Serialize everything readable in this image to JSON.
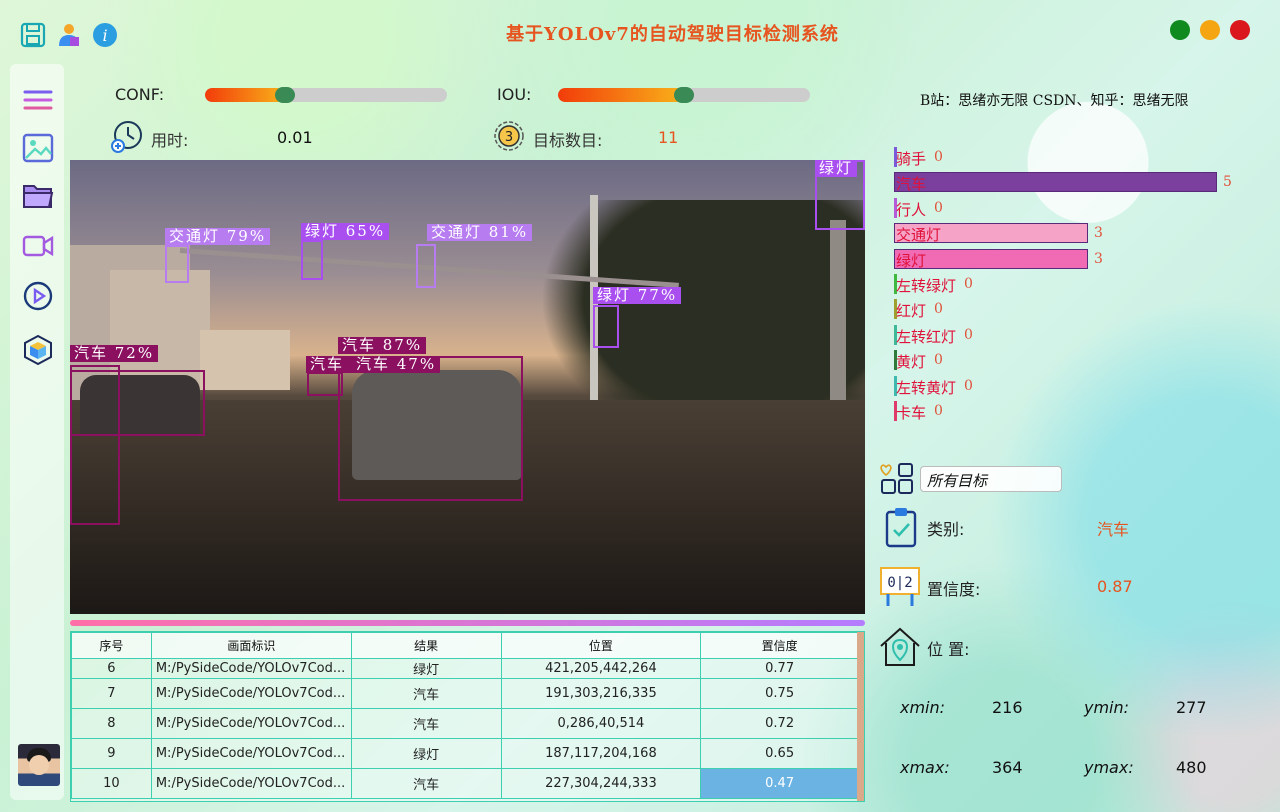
{
  "window": {
    "title": "基于YOLOv7的自动驾驶目标检测系统",
    "buttons": {
      "close_color": "#d9171c",
      "minimize_color": "#f5a511",
      "maximize_color": "#0f8a1e"
    }
  },
  "top_icons": [
    "save-icon",
    "user-icon",
    "info-icon"
  ],
  "sidebar": [
    "menu-icon",
    "image-icon",
    "folder-icon",
    "video-icon",
    "play-icon",
    "cube-icon",
    "avatar"
  ],
  "controls": {
    "conf_label": "CONF:",
    "conf_value": 0.33,
    "iou_label": "IOU:",
    "iou_value": 0.5,
    "time_label": "用时:",
    "time_value": "0.01",
    "count_label": "目标数目:",
    "count_value": "11"
  },
  "detections": [
    {
      "label": "汽车  72%"
    },
    {
      "label": "汽车  87%"
    },
    {
      "label": "汽车  47%"
    },
    {
      "label": "汽车"
    },
    {
      "label": "交通灯  79%"
    },
    {
      "label": "绿灯  65%"
    },
    {
      "label": "交通灯  81%"
    },
    {
      "label": "绿灯  77%"
    },
    {
      "label": "绿灯"
    }
  ],
  "table": {
    "headers": [
      "序号",
      "画面标识",
      "结果",
      "位置",
      "置信度"
    ],
    "rows": [
      [
        "6",
        "M:/PySideCode/YOLOv7Cod...",
        "绿灯",
        "421,205,442,264",
        "0.77"
      ],
      [
        "7",
        "M:/PySideCode/YOLOv7Cod...",
        "汽车",
        "191,303,216,335",
        "0.75"
      ],
      [
        "8",
        "M:/PySideCode/YOLOv7Cod...",
        "汽车",
        "0,286,40,514",
        "0.72"
      ],
      [
        "9",
        "M:/PySideCode/YOLOv7Cod...",
        "绿灯",
        "187,117,204,168",
        "0.65"
      ],
      [
        "10",
        "M:/PySideCode/YOLOv7Cod...",
        "汽车",
        "227,304,244,333",
        "0.47"
      ]
    ]
  },
  "credit": "B站：思绪亦无限  CSDN、知乎：思绪无限",
  "chart": {
    "max": 5,
    "bars": [
      {
        "name": "骑手",
        "value": 0,
        "color": "#7a5ad9",
        "text": "#e0113a"
      },
      {
        "name": "汽车",
        "value": 5,
        "color": "#7b3f9e",
        "text": "#e0113a"
      },
      {
        "name": "行人",
        "value": 0,
        "color": "#b45ad9",
        "text": "#e0113a"
      },
      {
        "name": "交通灯",
        "value": 3,
        "color": "#f5a3c7",
        "text": "#e0113a"
      },
      {
        "name": "绿灯",
        "value": 3,
        "color": "#f06bb4",
        "text": "#e0113a"
      },
      {
        "name": "左转绿灯",
        "value": 0,
        "color": "#3fb83f",
        "text": "#e0113a"
      },
      {
        "name": "红灯",
        "value": 0,
        "color": "#a0a030",
        "text": "#e0113a"
      },
      {
        "name": "左转红灯",
        "value": 0,
        "color": "#3fb89a",
        "text": "#e0113a"
      },
      {
        "name": "黄灯",
        "value": 0,
        "color": "#2f7a3a",
        "text": "#e0113a"
      },
      {
        "name": "左转黄灯",
        "value": 0,
        "color": "#3fb8b0",
        "text": "#e0113a"
      },
      {
        "name": "卡车",
        "value": 0,
        "color": "#e03a6a",
        "text": "#e0113a"
      }
    ]
  },
  "detail": {
    "target_select": "所有目标",
    "class_label": "类别:",
    "class_value": "汽车",
    "conf_label": "置信度:",
    "conf_value": "0.87",
    "pos_label": "位 置:",
    "xmin_label": "xmin:",
    "xmin": "216",
    "ymin_label": "ymin:",
    "ymin": "277",
    "xmax_label": "xmax:",
    "xmax": "364",
    "ymax_label": "ymax:",
    "ymax": "480"
  }
}
